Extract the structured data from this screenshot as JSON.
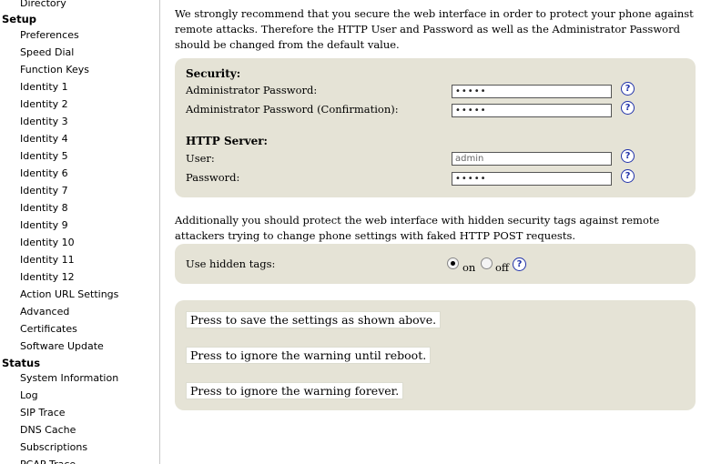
{
  "sidebar": {
    "top_item": "Directory",
    "setup_heading": "Setup",
    "setup_items": [
      "Preferences",
      "Speed Dial",
      "Function Keys",
      "Identity 1",
      "Identity 2",
      "Identity 3",
      "Identity 4",
      "Identity 5",
      "Identity 6",
      "Identity 7",
      "Identity 8",
      "Identity 9",
      "Identity 10",
      "Identity 11",
      "Identity 12",
      "Action URL Settings",
      "Advanced",
      "Certificates",
      "Software Update"
    ],
    "status_heading": "Status",
    "status_items": [
      "System Information",
      "Log",
      "SIP Trace",
      "DNS Cache",
      "Subscriptions",
      "PCAP Trace"
    ]
  },
  "intro_text": "We strongly recommend that you secure the web interface in order to protect your phone against remote attacks. Therefore the HTTP User and Password as well as the Administrator Password should be changed from the default value.",
  "security": {
    "heading": "Security:",
    "admin_password_label": "Administrator Password:",
    "admin_password_value": "•••••",
    "admin_password_confirm_label": "Administrator Password (Confirmation):",
    "admin_password_confirm_value": "•••••"
  },
  "http_server": {
    "heading": "HTTP Server:",
    "user_label": "User:",
    "user_value": "admin",
    "password_label": "Password:",
    "password_value": "•••••"
  },
  "help_glyph": "?",
  "hidden_tags_text": "Additionally you should protect the web interface with hidden security tags against remote attackers trying to change phone settings with faked HTTP POST requests.",
  "hidden_tags": {
    "label": "Use hidden tags:",
    "on_label": "on",
    "off_label": "off",
    "selected": "on"
  },
  "buttons": {
    "save": "Press to save the settings as shown above.",
    "ignore_reboot": "Press to ignore the warning until reboot.",
    "ignore_forever": "Press to ignore the warning forever."
  },
  "colors": {
    "panel_bg": "#e5e3d6",
    "help_blue": "#2233aa"
  }
}
